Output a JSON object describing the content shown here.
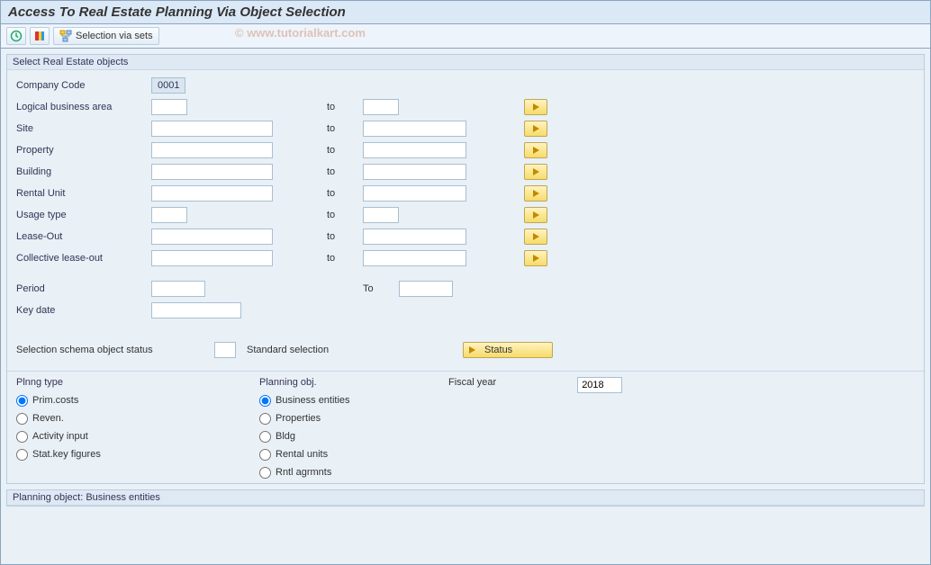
{
  "title": "Access To Real Estate Planning Via Object Selection",
  "toolbar": {
    "execute_tip": "Execute",
    "variant_tip": "Get Variant",
    "sel_sets_label": "Selection via sets"
  },
  "watermark": "© www.tutorialkart.com",
  "group1": {
    "legend": "Select Real Estate objects",
    "company_code": {
      "label": "Company Code",
      "value": "0001"
    },
    "rows": [
      {
        "label": "Logical business area",
        "from": "",
        "to_label": "to",
        "to": "",
        "short": true
      },
      {
        "label": "Site",
        "from": "",
        "to_label": "to",
        "to": "",
        "short": false
      },
      {
        "label": "Property",
        "from": "",
        "to_label": "to",
        "to": "",
        "short": false
      },
      {
        "label": "Building",
        "from": "",
        "to_label": "to",
        "to": "",
        "short": false
      },
      {
        "label": "Rental Unit",
        "from": "",
        "to_label": "to",
        "to": "",
        "short": false
      },
      {
        "label": "Usage type",
        "from": "",
        "to_label": "to",
        "to": "",
        "short": true
      },
      {
        "label": "Lease-Out",
        "from": "",
        "to_label": "to",
        "to": "",
        "short": false
      },
      {
        "label": "Collective lease-out",
        "from": "",
        "to_label": "to",
        "to": "",
        "short": false
      }
    ],
    "period": {
      "label": "Period",
      "from": "",
      "to_label": "To",
      "to": ""
    },
    "keydate": {
      "label": "Key date",
      "value": ""
    },
    "schema": {
      "label": "Selection schema object status",
      "value": "",
      "text": "Standard selection"
    },
    "status_btn": "Status"
  },
  "plan": {
    "plnng_type_label": "Plnng type",
    "planning_obj_label": "Planning obj.",
    "fiscal_year_label": "Fiscal year",
    "fiscal_year_value": "2018",
    "types": [
      {
        "label": "Prim.costs",
        "checked": true
      },
      {
        "label": "Reven.",
        "checked": false
      },
      {
        "label": "Activity input",
        "checked": false
      },
      {
        "label": "Stat.key figures",
        "checked": false
      }
    ],
    "objs": [
      {
        "label": "Business entities",
        "checked": true
      },
      {
        "label": "Properties",
        "checked": false
      },
      {
        "label": "Bldg",
        "checked": false
      },
      {
        "label": "Rental units",
        "checked": false
      },
      {
        "label": "Rntl agrmnts",
        "checked": false
      }
    ]
  },
  "footer": {
    "legend": "Planning object: Business entities"
  }
}
